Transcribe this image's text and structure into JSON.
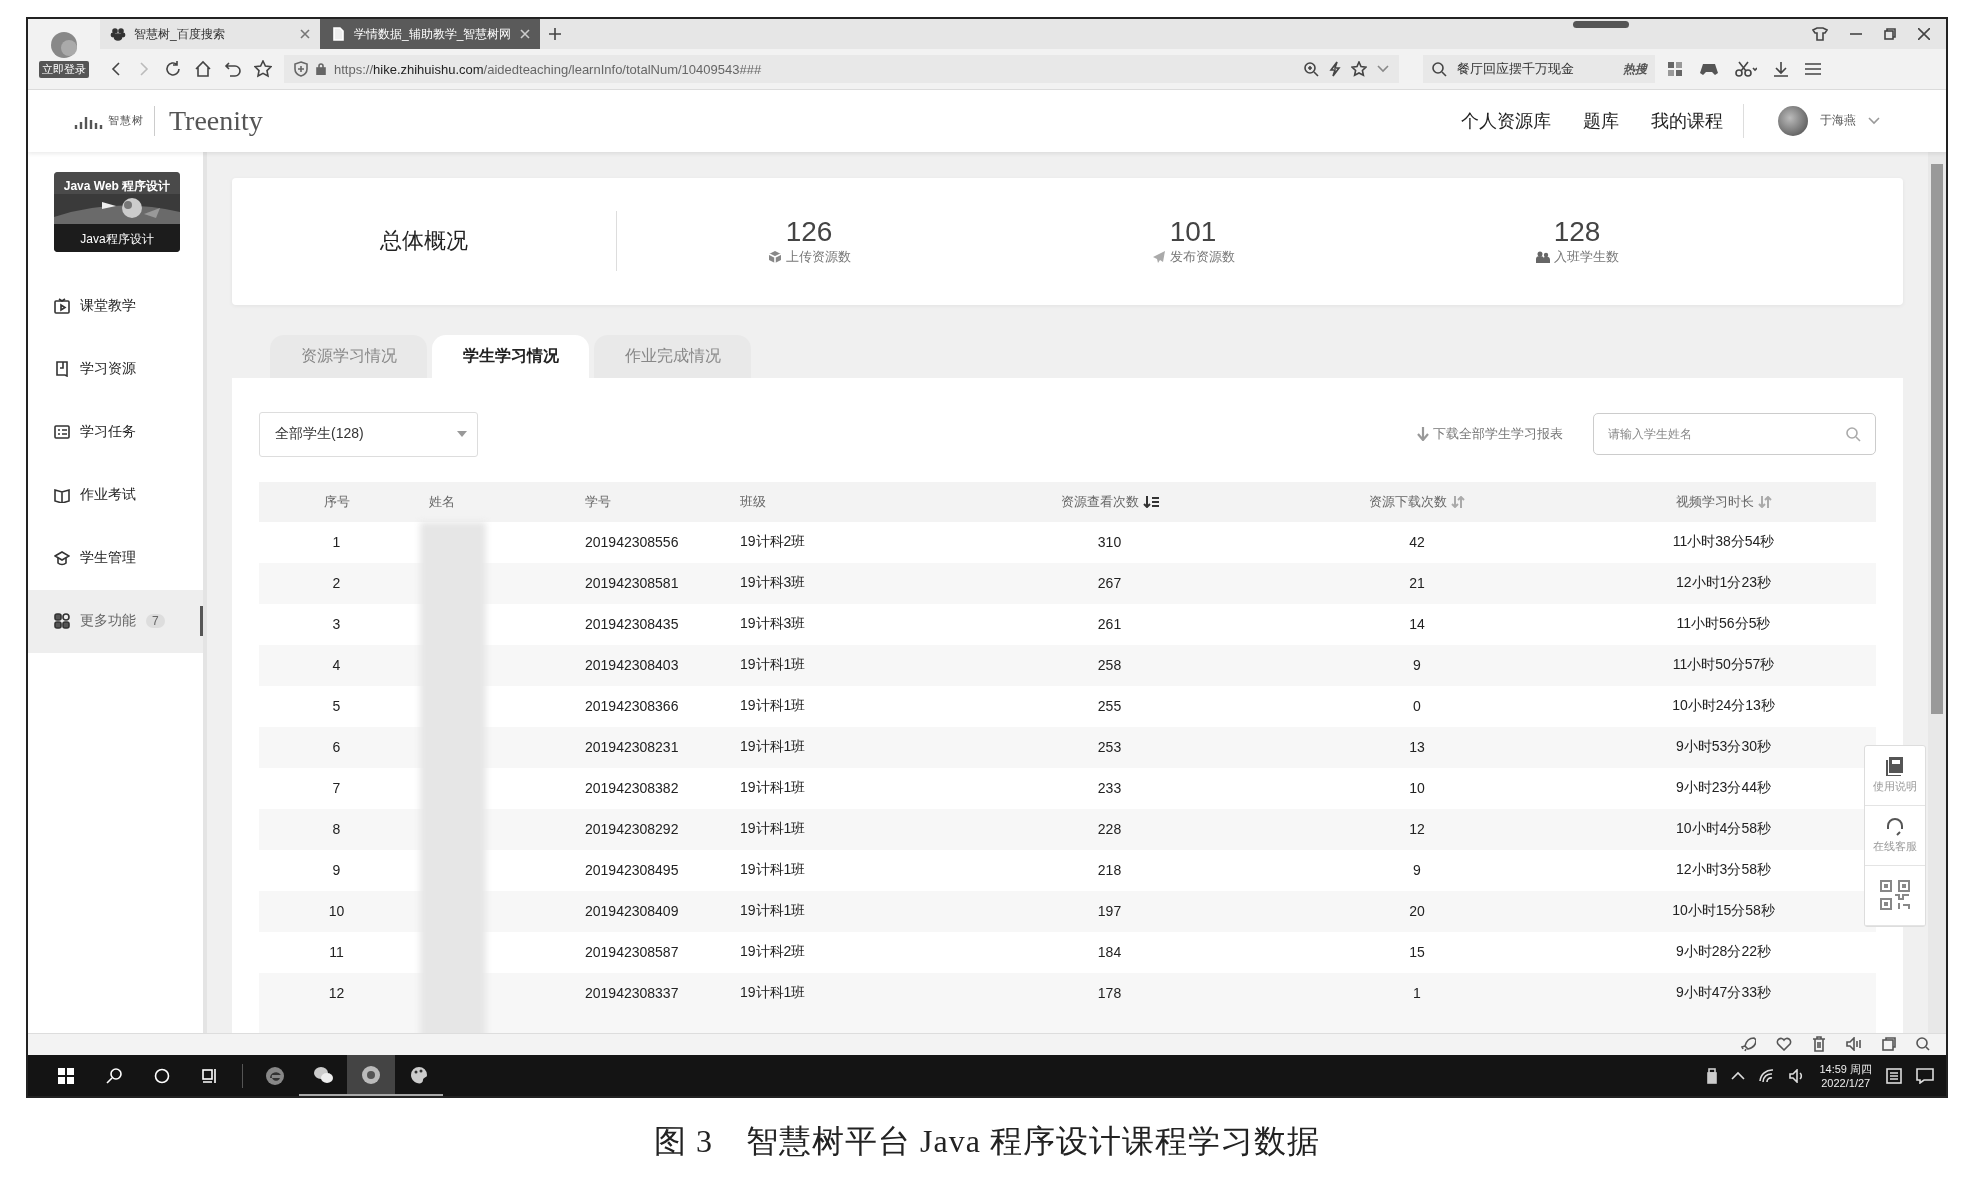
{
  "browser": {
    "login_label": "立即登录",
    "tabs": [
      {
        "title": "智慧树_百度搜索",
        "selected": false,
        "kind": "paw"
      },
      {
        "title": "学情数据_辅助教学_智慧树网",
        "selected": true,
        "kind": "page"
      }
    ],
    "url": "https://**hike.zhihuishu.com**/aidedteaching/learnInfo/totalNum/10409543###",
    "search": {
      "value": "餐厅回应摆千万现金",
      "hot_label": "热搜"
    }
  },
  "header": {
    "logo_text": "智慧树",
    "brand": "Treenity",
    "nav": [
      "个人资源库",
      "题库",
      "我的课程"
    ],
    "user": "于海燕"
  },
  "sidebar": {
    "course": {
      "title": "Java Web 程序设计",
      "subtitle": "Java程序设计"
    },
    "items": [
      {
        "label": "课堂教学",
        "kind": "tv",
        "selected": false
      },
      {
        "label": "学习资源",
        "kind": "doc",
        "selected": false
      },
      {
        "label": "学习任务",
        "kind": "list",
        "selected": false
      },
      {
        "label": "作业考试",
        "kind": "book",
        "selected": false
      },
      {
        "label": "学生管理",
        "kind": "cap",
        "selected": false
      },
      {
        "label": "更多功能",
        "kind": "apps",
        "selected": true,
        "badge": "7"
      }
    ]
  },
  "overview": {
    "title": "总体概况",
    "stats": [
      {
        "value": "126",
        "label": "上传资源数",
        "kind": "box"
      },
      {
        "value": "101",
        "label": "发布资源数",
        "kind": "send"
      },
      {
        "value": "128",
        "label": "入班学生数",
        "kind": "people"
      }
    ]
  },
  "tabs": [
    {
      "label": "资源学习情况",
      "selected": false
    },
    {
      "label": "学生学习情况",
      "selected": true
    },
    {
      "label": "作业完成情况",
      "selected": false
    }
  ],
  "filter": {
    "value": "全部学生(128)"
  },
  "download_label": "下载全部学生学习报表",
  "student_search": {
    "placeholder": "请输入学生姓名"
  },
  "table": {
    "columns": [
      {
        "label": "序号"
      },
      {
        "label": "姓名"
      },
      {
        "label": "学号"
      },
      {
        "label": "班级"
      },
      {
        "label": "资源查看次数",
        "sorted": true
      },
      {
        "label": "资源下载次数",
        "sorted": false
      },
      {
        "label": "视频学习时长",
        "sorted": false
      }
    ],
    "rows": [
      {
        "index": "1",
        "student_id": "201942308556",
        "class": "19计科2班",
        "views": "310",
        "downloads": "42",
        "video_time": "11小时38分54秒"
      },
      {
        "index": "2",
        "student_id": "201942308581",
        "class": "19计科3班",
        "views": "267",
        "downloads": "21",
        "video_time": "12小时1分23秒"
      },
      {
        "index": "3",
        "student_id": "201942308435",
        "class": "19计科3班",
        "views": "261",
        "downloads": "14",
        "video_time": "11小时56分5秒"
      },
      {
        "index": "4",
        "student_id": "201942308403",
        "class": "19计科1班",
        "views": "258",
        "downloads": "9",
        "video_time": "11小时50分57秒"
      },
      {
        "index": "5",
        "student_id": "201942308366",
        "class": "19计科1班",
        "views": "255",
        "downloads": "0",
        "video_time": "10小时24分13秒"
      },
      {
        "index": "6",
        "student_id": "201942308231",
        "class": "19计科1班",
        "views": "253",
        "downloads": "13",
        "video_time": "9小时53分30秒"
      },
      {
        "index": "7",
        "student_id": "201942308382",
        "class": "19计科1班",
        "views": "233",
        "downloads": "10",
        "video_time": "9小时23分44秒"
      },
      {
        "index": "8",
        "student_id": "201942308292",
        "class": "19计科1班",
        "views": "228",
        "downloads": "12",
        "video_time": "10小时4分58秒"
      },
      {
        "index": "9",
        "student_id": "201942308495",
        "class": "19计科1班",
        "views": "218",
        "downloads": "9",
        "video_time": "12小时3分58秒"
      },
      {
        "index": "10",
        "student_id": "201942308409",
        "class": "19计科1班",
        "views": "197",
        "downloads": "20",
        "video_time": "10小时15分58秒"
      },
      {
        "index": "11",
        "student_id": "201942308587",
        "class": "19计科2班",
        "views": "184",
        "downloads": "15",
        "video_time": "9小时28分22秒"
      },
      {
        "index": "12",
        "student_id": "201942308337",
        "class": "19计科1班",
        "views": "178",
        "downloads": "1",
        "video_time": "9小时47分33秒"
      }
    ]
  },
  "side_widget": [
    {
      "label": "使用说明",
      "kind": "book"
    },
    {
      "label": "在线客服",
      "kind": "headset"
    },
    {
      "kind": "qr"
    }
  ],
  "taskbar": {
    "apps": [
      {
        "kind": "edge",
        "running": false,
        "selected": false
      },
      {
        "kind": "chat",
        "running": true,
        "selected": false
      },
      {
        "kind": "browser",
        "running": true,
        "selected": true
      },
      {
        "kind": "paint",
        "running": true,
        "selected": false
      }
    ],
    "time": "14:59 周四",
    "date": "2022/1/27"
  },
  "caption": "图 3　智慧树平台 Java 程序设计课程学习数据"
}
